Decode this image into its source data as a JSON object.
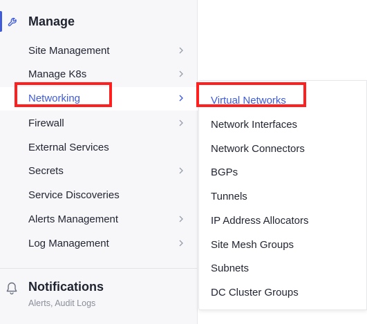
{
  "manage": {
    "title": "Manage",
    "icon": "wrench-icon",
    "accent_color": "#3f5bd9"
  },
  "menu": {
    "items": [
      {
        "label": "Site Management",
        "has_submenu": true
      },
      {
        "label": "Manage K8s",
        "has_submenu": true
      },
      {
        "label": "Networking",
        "has_submenu": true,
        "active": true
      },
      {
        "label": "Firewall",
        "has_submenu": true
      },
      {
        "label": "External Services",
        "has_submenu": false
      },
      {
        "label": "Secrets",
        "has_submenu": true
      },
      {
        "label": "Service Discoveries",
        "has_submenu": false
      },
      {
        "label": "Alerts Management",
        "has_submenu": true
      },
      {
        "label": "Log Management",
        "has_submenu": true
      }
    ]
  },
  "networking_submenu": {
    "items": [
      {
        "label": "Virtual Networks",
        "active": true
      },
      {
        "label": "Network Interfaces"
      },
      {
        "label": "Network Connectors"
      },
      {
        "label": "BGPs"
      },
      {
        "label": "Tunnels"
      },
      {
        "label": "IP Address Allocators"
      },
      {
        "label": "Site Mesh Groups"
      },
      {
        "label": "Subnets"
      },
      {
        "label": "DC Cluster Groups"
      }
    ]
  },
  "notifications": {
    "title": "Notifications",
    "subtitle": "Alerts, Audit Logs",
    "icon": "bell-icon"
  },
  "highlight_color": "#ff1f1f"
}
